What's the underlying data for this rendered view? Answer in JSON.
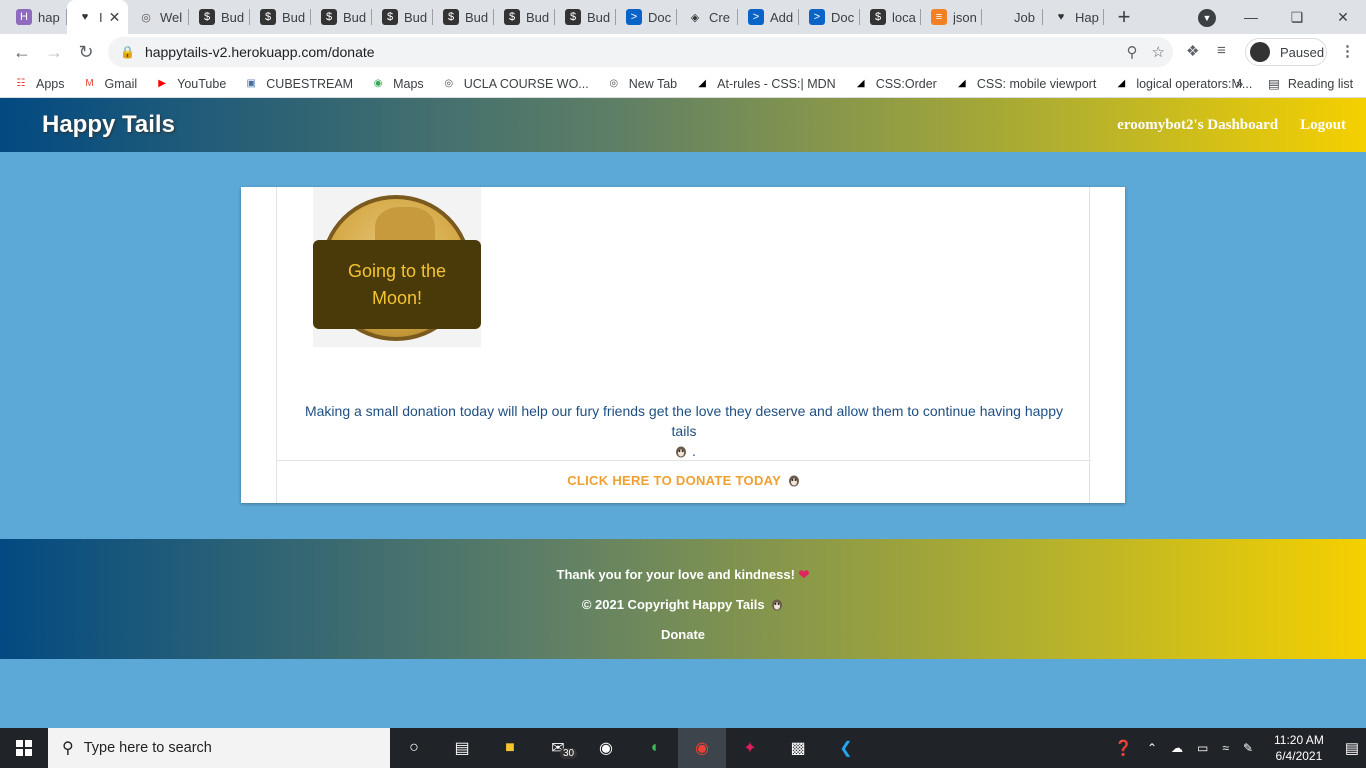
{
  "browser": {
    "tabs": [
      {
        "title": "hap",
        "icon": "H",
        "icon_bg": "#8e6bbf",
        "icon_color": "#fff"
      },
      {
        "title": "I",
        "icon": "♥",
        "icon_bg": "#ffffff",
        "icon_color": "#333",
        "active": true
      },
      {
        "title": "Wel",
        "icon": "◎",
        "icon_bg": "#dee1e6",
        "icon_color": "#555"
      },
      {
        "title": "Bud",
        "icon": "$",
        "icon_bg": "#333",
        "icon_color": "#fff"
      },
      {
        "title": "Bud",
        "icon": "$",
        "icon_bg": "#333",
        "icon_color": "#fff"
      },
      {
        "title": "Bud",
        "icon": "$",
        "icon_bg": "#333",
        "icon_color": "#fff"
      },
      {
        "title": "Bud",
        "icon": "$",
        "icon_bg": "#333",
        "icon_color": "#fff"
      },
      {
        "title": "Bud",
        "icon": "$",
        "icon_bg": "#333",
        "icon_color": "#fff"
      },
      {
        "title": "Bud",
        "icon": "$",
        "icon_bg": "#333",
        "icon_color": "#fff"
      },
      {
        "title": "Bud",
        "icon": "$",
        "icon_bg": "#333",
        "icon_color": "#fff"
      },
      {
        "title": "Doc",
        "icon": ">",
        "icon_bg": "#0a64c8",
        "icon_color": "#fff"
      },
      {
        "title": "Cre",
        "icon": "◈",
        "icon_bg": "#dee1e6",
        "icon_color": "#333"
      },
      {
        "title": "Add",
        "icon": ">",
        "icon_bg": "#0a64c8",
        "icon_color": "#fff"
      },
      {
        "title": "Doc",
        "icon": ">",
        "icon_bg": "#0a64c8",
        "icon_color": "#fff"
      },
      {
        "title": "loca",
        "icon": "$",
        "icon_bg": "#333",
        "icon_color": "#fff"
      },
      {
        "title": "json",
        "icon": "≡",
        "icon_bg": "#f48024",
        "icon_color": "#fff"
      },
      {
        "title": "Job",
        "icon": "",
        "icon_bg": "#dee1e6",
        "icon_color": "#333"
      },
      {
        "title": "Hap",
        "icon": "♥",
        "icon_bg": "#dee1e6",
        "icon_color": "#333"
      }
    ],
    "url": "happytails-v2.herokuapp.com/donate",
    "profile_status": "Paused",
    "bookmarks": [
      {
        "label": "Apps",
        "icon": "apps-grid-icon",
        "glyph": "☷",
        "color": "#e94235"
      },
      {
        "label": "Gmail",
        "icon": "gmail-icon",
        "glyph": "M",
        "color": "#ea4335"
      },
      {
        "label": "YouTube",
        "icon": "youtube-icon",
        "glyph": "▶",
        "color": "#ff0000"
      },
      {
        "label": "CUBESTREAM",
        "icon": "cube-icon",
        "glyph": "▣",
        "color": "#4a6fa5"
      },
      {
        "label": "Maps",
        "icon": "maps-pin-icon",
        "glyph": "◉",
        "color": "#34a853"
      },
      {
        "label": "UCLA COURSE WO...",
        "icon": "globe-icon",
        "glyph": "◎",
        "color": "#555"
      },
      {
        "label": "New Tab",
        "icon": "globe-icon",
        "glyph": "◎",
        "color": "#555"
      },
      {
        "label": "At-rules - CSS:| MDN",
        "icon": "mdn-icon",
        "glyph": "◢",
        "color": "#000"
      },
      {
        "label": "CSS:Order",
        "icon": "mdn-icon",
        "glyph": "◢",
        "color": "#000"
      },
      {
        "label": "CSS: mobile viewport",
        "icon": "mdn-icon",
        "glyph": "◢",
        "color": "#000"
      },
      {
        "label": "logical operators:M...",
        "icon": "mdn-icon",
        "glyph": "◢",
        "color": "#000"
      }
    ],
    "bookmarks_more": "»",
    "reading_list": "Reading list"
  },
  "site": {
    "brand": "Happy Tails",
    "nav": {
      "dashboard": "eroomybot2's Dashboard",
      "logout": "Logout"
    },
    "card": {
      "badge_text": "Going to the Moon!",
      "message": "Making a small donation today will help our fury friends get the love they deserve and allow them to continue having happy tails",
      "message_suffix": ".",
      "donate_cta": "CLICK HERE TO DONATE TODAY"
    },
    "footer": {
      "thanks": "Thank you for your love and kindness!",
      "copyright": "© 2021 Copyright Happy Tails",
      "donate_link": "Donate"
    }
  },
  "taskbar": {
    "search_placeholder": "Type here to search",
    "mail_badge": "30",
    "time": "11:20 AM",
    "date": "6/4/2021"
  }
}
